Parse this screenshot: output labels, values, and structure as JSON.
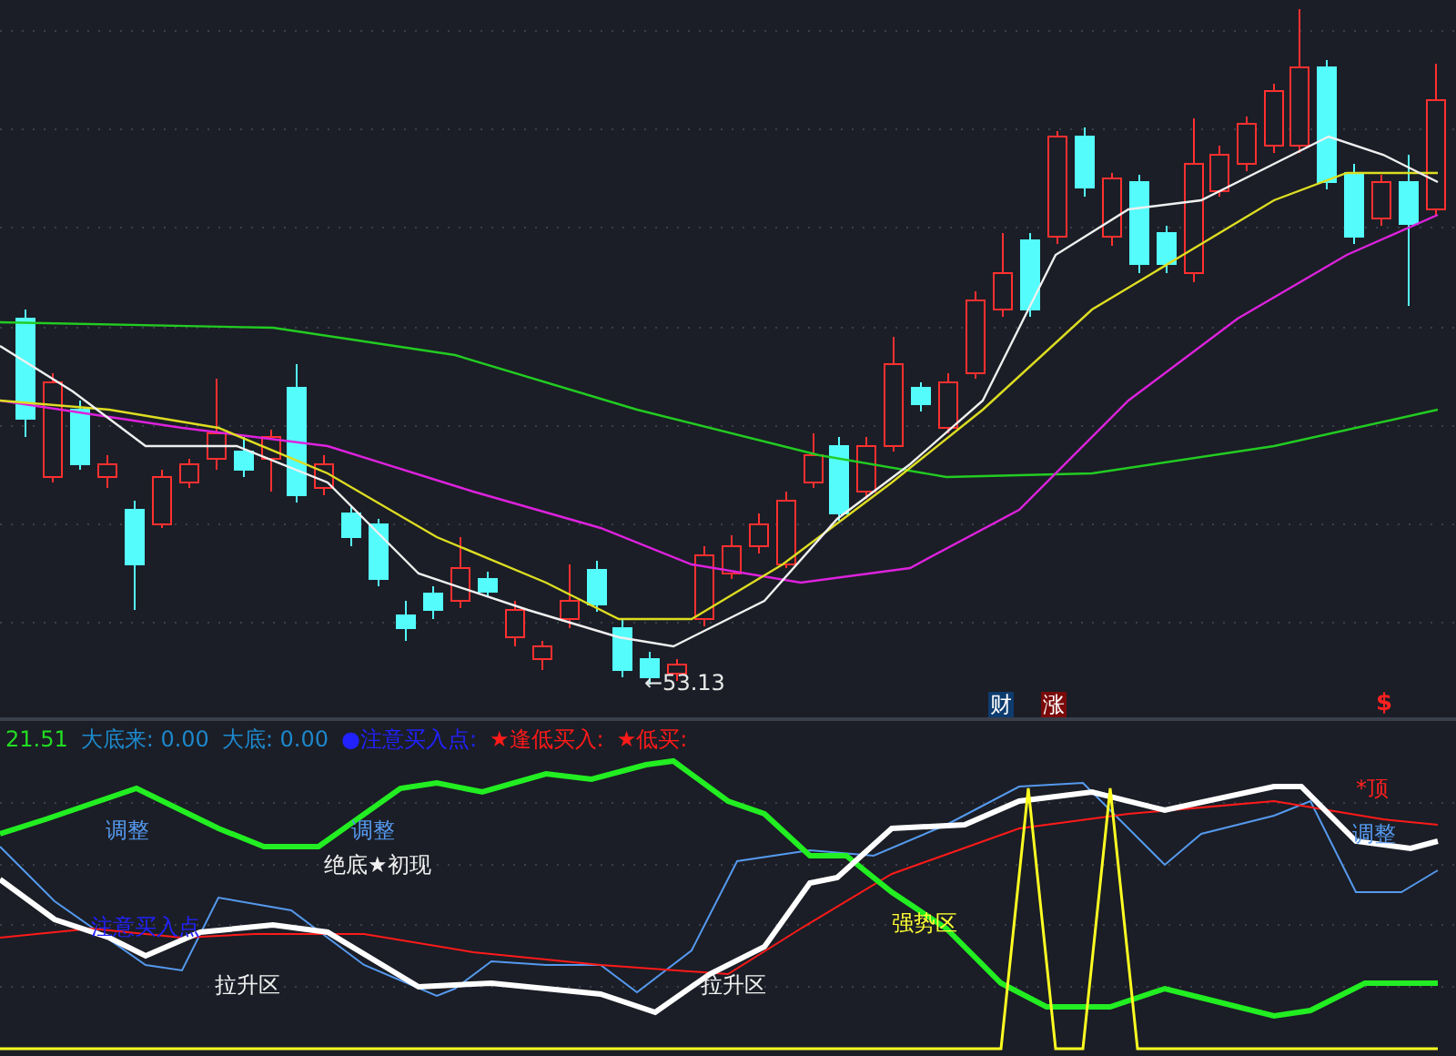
{
  "price_chart": {
    "low_label": "←53.13",
    "markers": [
      {
        "kind": "badge",
        "text": "财",
        "color": "#0d3b6e"
      },
      {
        "kind": "badge",
        "text": "涨",
        "color": "#7a0a0a"
      },
      {
        "kind": "glyph",
        "text": "$",
        "color": "#ff2020"
      }
    ]
  },
  "legend": [
    {
      "text": "21.51",
      "color": "#22dd22"
    },
    {
      "text": "大底来: 0.00",
      "color": "#1e88cc"
    },
    {
      "text": "大底: 0.00",
      "color": "#1e88cc"
    },
    {
      "text": "●注意买入点:",
      "color": "#2222ff"
    },
    {
      "text": "★逢低买入:",
      "color": "#ff1a1a"
    },
    {
      "text": "★低买:",
      "color": "#ff1a1a"
    }
  ],
  "indicator_labels": [
    {
      "text": "调整",
      "color": "#5599ee"
    },
    {
      "text": "调整",
      "color": "#5599ee"
    },
    {
      "text": "绝底★初现",
      "color": "#f0f0f0"
    },
    {
      "text": "注意买入点",
      "color": "#2222ff"
    },
    {
      "text": "拉升区",
      "color": "#f0f0f0"
    },
    {
      "text": "拉升区",
      "color": "#f0f0f0"
    },
    {
      "text": "强势区",
      "color": "#ffff33"
    },
    {
      "text": "*顶",
      "color": "#ff2020"
    },
    {
      "text": "调整",
      "color": "#5599ee"
    }
  ]
}
